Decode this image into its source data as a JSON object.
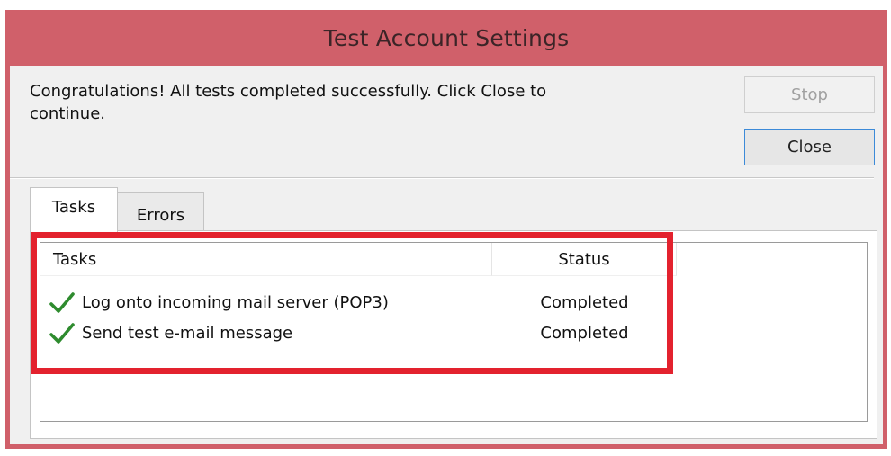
{
  "window": {
    "title": "Test Account Settings"
  },
  "message": "Congratulations! All tests completed successfully. Click Close to\ncontinue.",
  "buttons": {
    "stop_label": "Stop",
    "close_label": "Close"
  },
  "tabs": [
    {
      "label": "Tasks",
      "selected": true
    },
    {
      "label": "Errors",
      "selected": false
    }
  ],
  "list": {
    "columns": [
      "Tasks",
      "Status"
    ],
    "rows": [
      {
        "icon": "checkmark-icon",
        "task": "Log onto incoming mail server (POP3)",
        "status": "Completed"
      },
      {
        "icon": "checkmark-icon",
        "task": "Send test e-mail message",
        "status": "Completed"
      }
    ]
  },
  "colors": {
    "titlebar": "#d0606a",
    "highlight": "#e3222e",
    "checkmark": "#2e8b2e",
    "focus_border": "#3c8ad8"
  }
}
